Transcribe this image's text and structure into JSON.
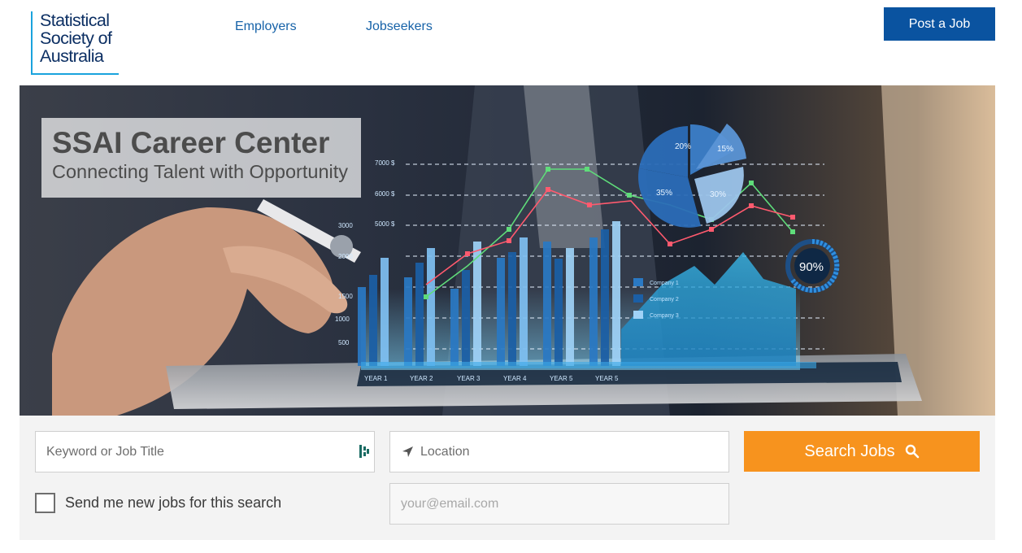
{
  "header": {
    "logo_lines": [
      "Statistical",
      "Society of",
      "Australia"
    ],
    "nav": [
      {
        "label": "Employers"
      },
      {
        "label": "Jobseekers"
      }
    ],
    "post_job_label": "Post a Job"
  },
  "hero": {
    "title": "SSAI Career Center",
    "subtitle": "Connecting Talent with Opportunity",
    "overlay_text": {
      "y_ticks": [
        "7000 $",
        "6000 $",
        "5000 $",
        "3000",
        "2000",
        "1500",
        "1000",
        "500"
      ],
      "x_ticks": [
        "YEAR 1",
        "YEAR 2",
        "YEAR 3",
        "YEAR 4",
        "YEAR 5",
        "YEAR 5"
      ],
      "pie_labels": [
        "20%",
        "15%",
        "35%",
        "30%"
      ],
      "gauge": "90%",
      "legend": [
        "Company 1",
        "Company 2",
        "Company 3"
      ]
    }
  },
  "search": {
    "keyword_placeholder": "Keyword or Job Title",
    "location_placeholder": "Location",
    "button_label": "Search Jobs",
    "alert_label": "Send me new jobs for this search",
    "email_placeholder": "your@email.com"
  },
  "colors": {
    "brand_blue": "#0a53a0",
    "nav_blue": "#1662a8",
    "search_orange": "#f7931e",
    "logo_accent": "#1aa3dd"
  },
  "icons": {
    "keyword_field": "password-manager-icon",
    "location_field": "location-arrow-icon",
    "search_button": "search-icon"
  }
}
